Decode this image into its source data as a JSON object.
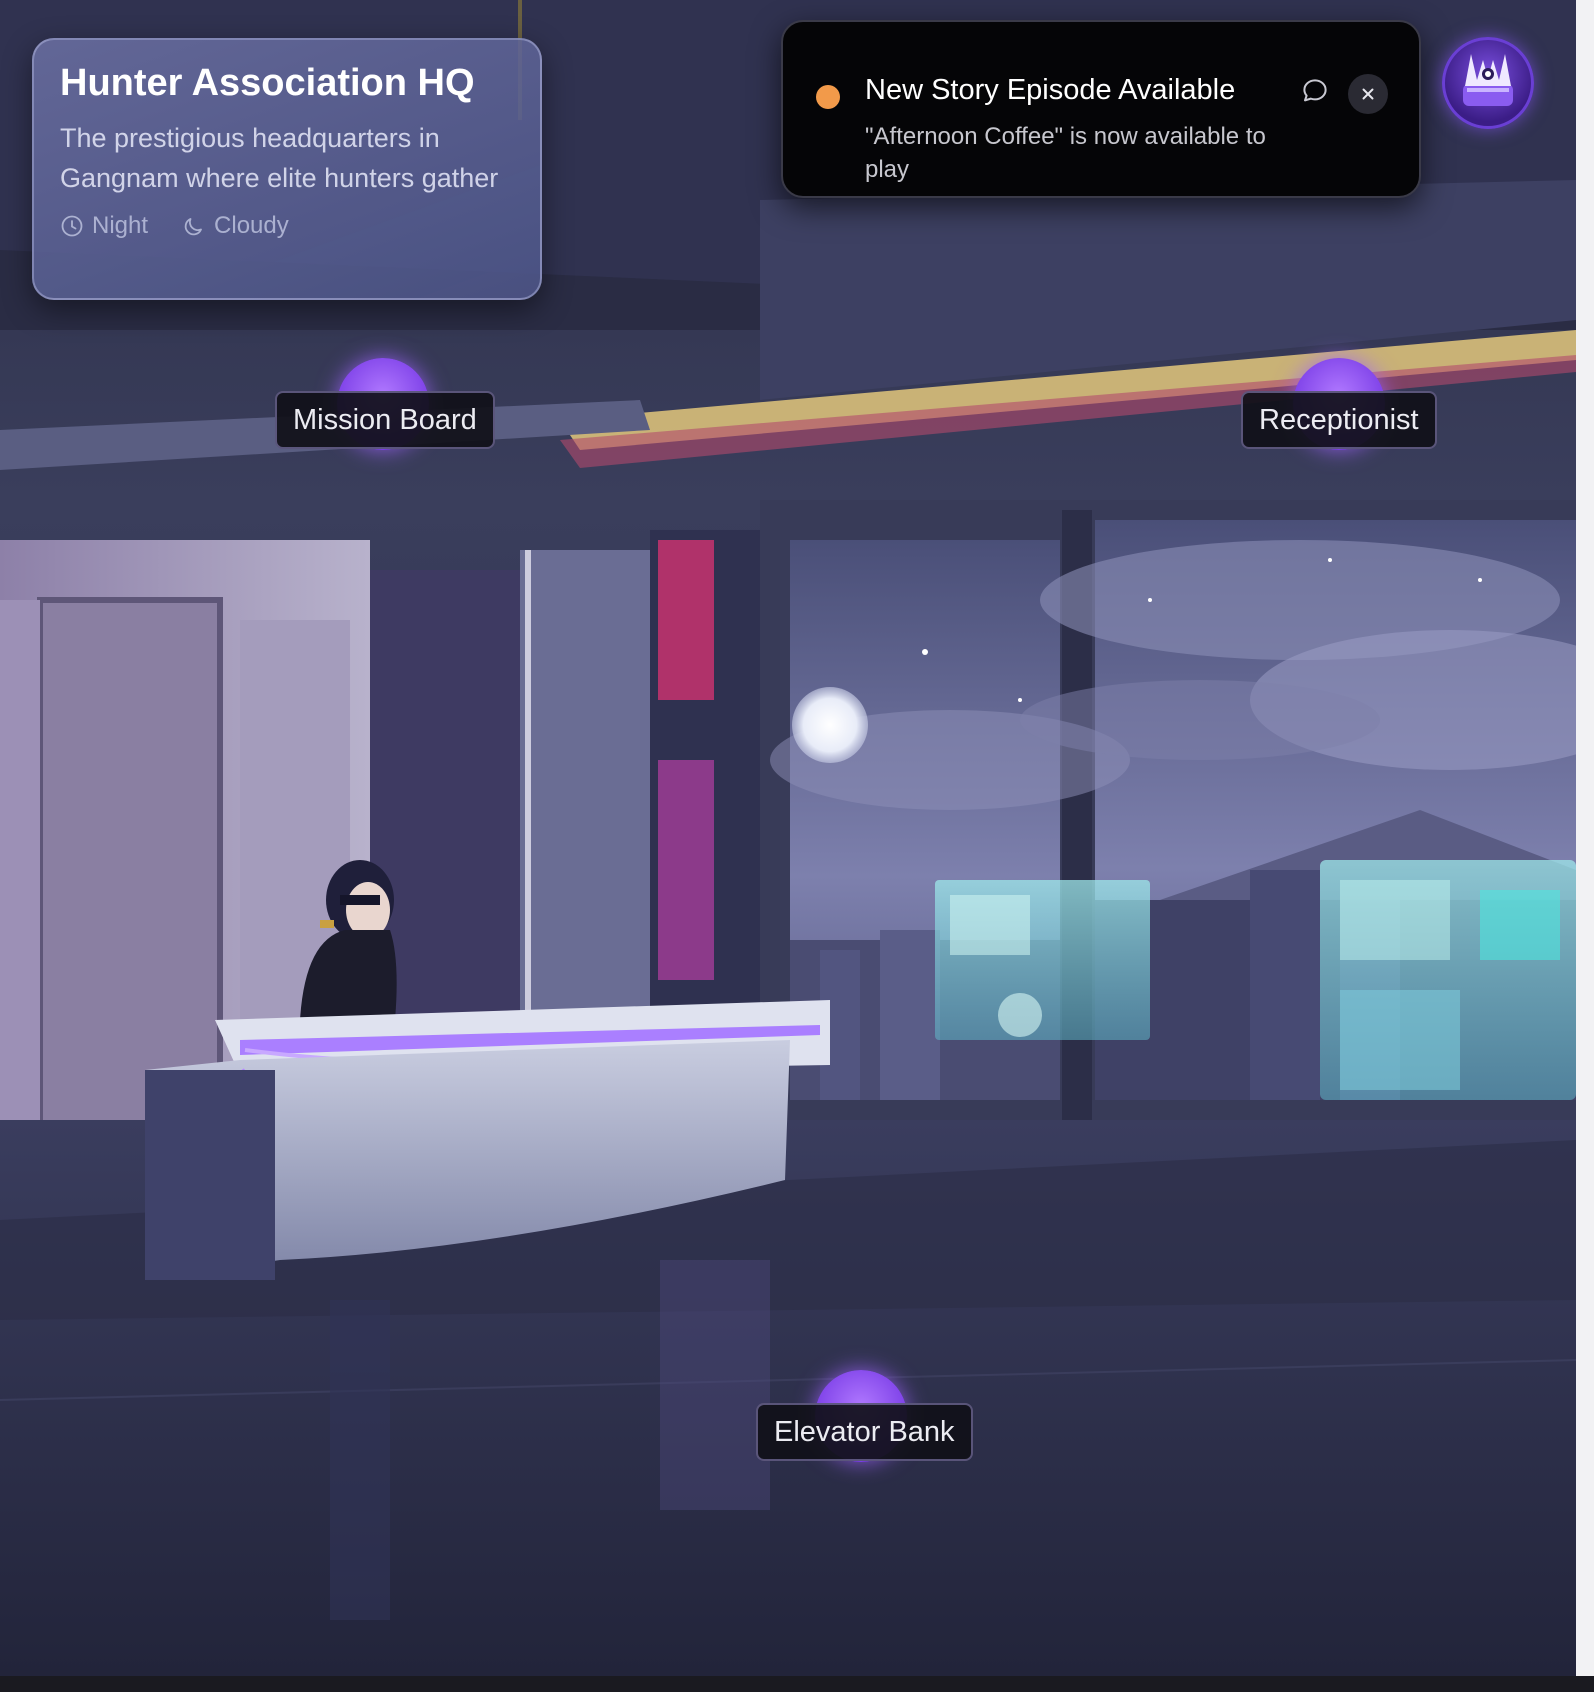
{
  "location": {
    "title": "Hunter Association HQ",
    "description": "The prestigious headquarters in Gangnam where elite hunters gather",
    "time_of_day": "Night",
    "weather": "Cloudy",
    "time_icon": "clock-icon",
    "weather_icon": "moon-icon"
  },
  "notification": {
    "title": "New Story Episode Available",
    "body": "\"Afternoon Coffee\" is now available to play",
    "status_color": "#f29a4a",
    "chat_icon": "chat-bubble-icon",
    "close_icon": "close-icon"
  },
  "avatar": {
    "icon": "crown-avatar-icon",
    "accent": "#7a3de6"
  },
  "hotspots": [
    {
      "label": "Mission Board",
      "icon": "mission-board-icon"
    },
    {
      "label": "Receptionist",
      "icon": "receptionist-icon"
    },
    {
      "label": "Elevator Bank",
      "icon": "elevator-icon"
    }
  ],
  "theme": {
    "accent": "#8b4dff",
    "neon": "#a779ff"
  }
}
